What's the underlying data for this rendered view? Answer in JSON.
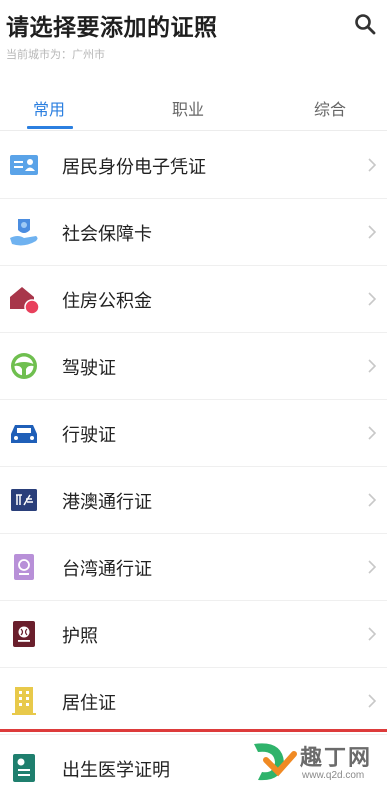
{
  "header": {
    "title": "请选择要添加的证照",
    "subtitle": "当前城市为：广州市",
    "search_icon": "search-icon"
  },
  "tabs": [
    {
      "label": "常用",
      "active": true
    },
    {
      "label": "职业",
      "active": false
    },
    {
      "label": "综合",
      "active": false
    }
  ],
  "items": [
    {
      "label": "居民身份电子凭证",
      "icon": "id-card-icon"
    },
    {
      "label": "社会保障卡",
      "icon": "social-security-icon"
    },
    {
      "label": "住房公积金",
      "icon": "housing-fund-icon"
    },
    {
      "label": "驾驶证",
      "icon": "steering-wheel-icon"
    },
    {
      "label": "行驶证",
      "icon": "car-icon"
    },
    {
      "label": "港澳通行证",
      "icon": "hk-macau-pass-icon"
    },
    {
      "label": "台湾通行证",
      "icon": "taiwan-pass-icon"
    },
    {
      "label": "护照",
      "icon": "passport-icon"
    },
    {
      "label": "居住证",
      "icon": "residence-permit-icon"
    },
    {
      "label": "出生医学证明",
      "icon": "birth-certificate-icon"
    }
  ],
  "watermark": {
    "text_main": "趣丁网",
    "text_url": "www.q2d.com"
  },
  "colors": {
    "accent": "#2b7fe0",
    "divider_red": "#dd3b3b"
  }
}
